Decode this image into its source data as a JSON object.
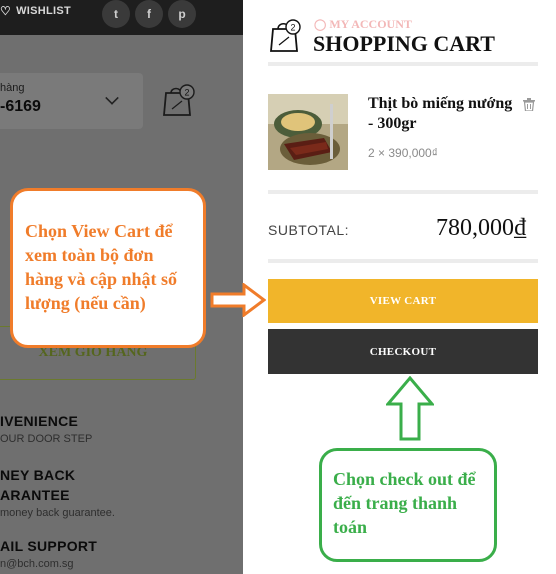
{
  "top_bar": {
    "wishlist_label": "WISHLIST",
    "social_icons": [
      "twitter-icon",
      "facebook-icon",
      "pinterest-icon"
    ]
  },
  "left_page": {
    "hotline_label": "hàng",
    "hotline_number": "-6169",
    "cart_badge_count": "2",
    "view_cart_button_label": "XEM GIỎ HÀNG",
    "features": [
      {
        "title": "IVENIENCE",
        "subtitle": "OUR DOOR STEP"
      },
      {
        "title": "NEY BACK",
        "subtitle": ""
      },
      {
        "title": "ARANTEE",
        "subtitle": "money back guarantee."
      },
      {
        "title": "AIL SUPPORT",
        "subtitle": "n@bch.com.sg"
      }
    ]
  },
  "cart_panel": {
    "badge_count": "2",
    "my_account_label": "MY ACCOUNT",
    "title": "SHOPPING CART",
    "item": {
      "name": "Thịt bò miếng nướng - 300gr",
      "quantity_price": "2 × 390,000₫"
    },
    "subtotal_label": "SUBTOTAL:",
    "subtotal_value": "780,000₫",
    "view_cart_label": "VIEW CART",
    "checkout_label": "CHECKOUT"
  },
  "annotations": {
    "orange_note": "Chọn View Cart để xem toàn bộ đơn hàng và cập nhật số lượng (nếu cần)",
    "green_note": "Chọn check out để đến trang thanh toán"
  },
  "colors": {
    "view_cart_bg": "#f1b52a",
    "checkout_bg": "#333333",
    "orange_annotation": "#f07c2a",
    "green_annotation": "#3aae4a",
    "my_account_pink": "#f3b8b8"
  }
}
